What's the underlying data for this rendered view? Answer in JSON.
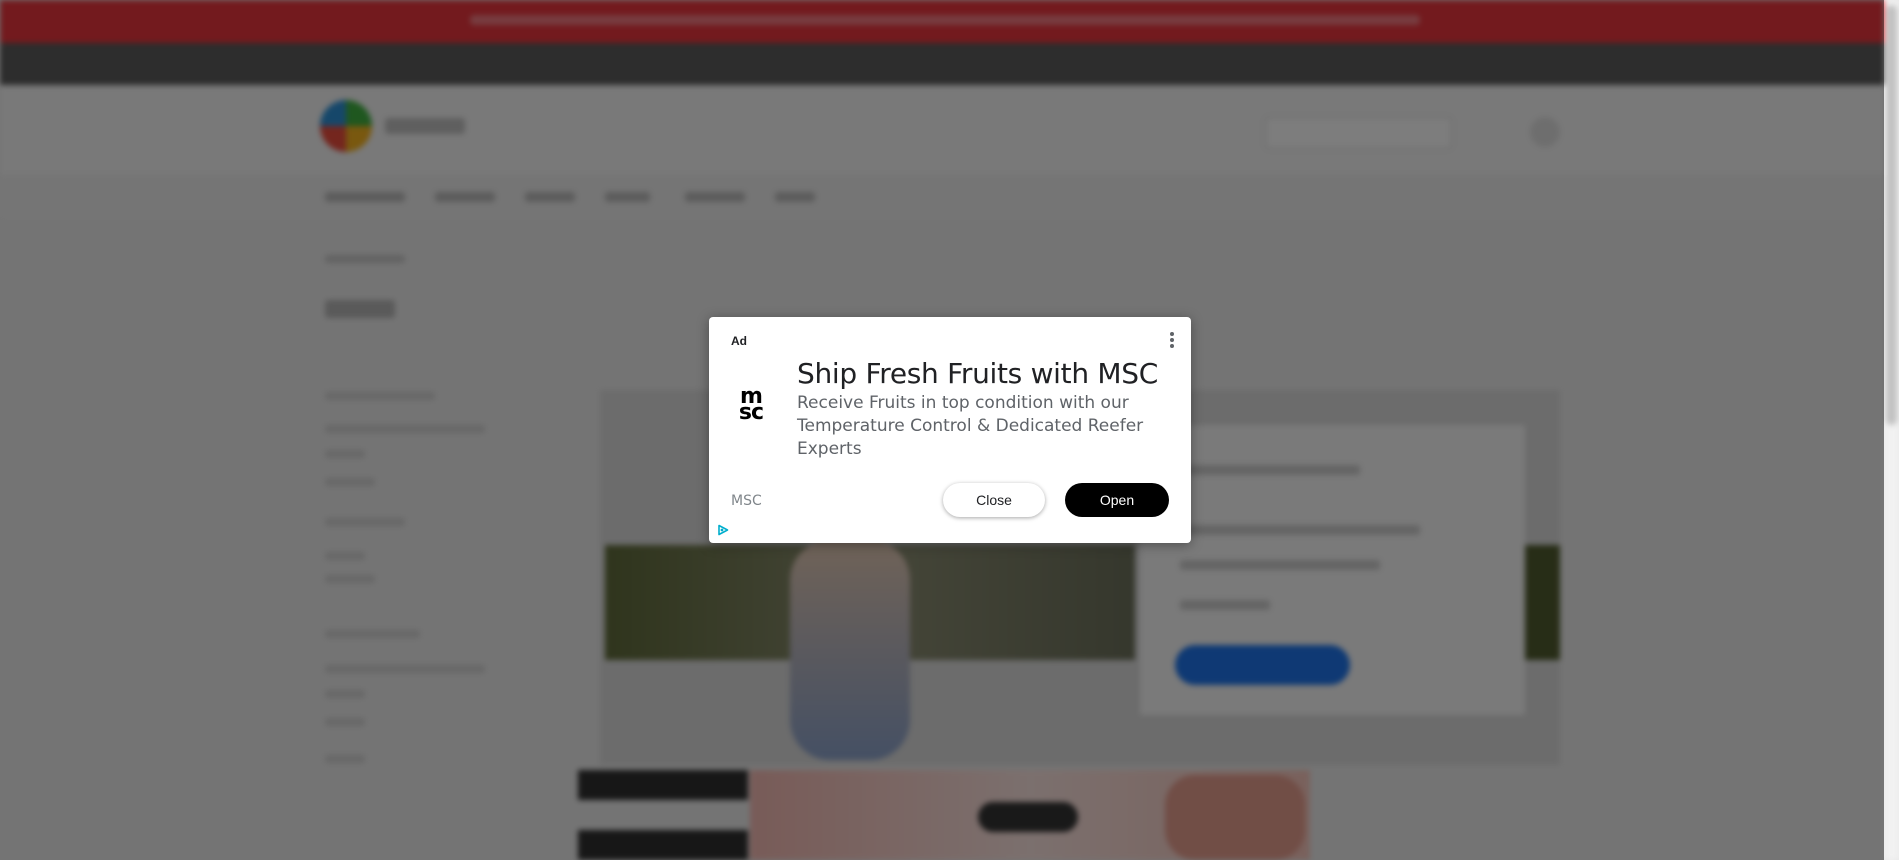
{
  "ad": {
    "label": "Ad",
    "headline": "Ship Fresh Fruits with MSC",
    "body": "Receive Fruits in top condition with our Temperature Control & Dedicated Reefer Experts",
    "advertiser": "MSC",
    "logo_line1": "m",
    "logo_line2": "sc",
    "close_label": "Close",
    "open_label": "Open",
    "icons": {
      "menu": "more-vert-icon",
      "adchoices": "adchoices-icon"
    }
  },
  "colors": {
    "top_banner": "#e6343c",
    "overlay": "rgba(0,0,0,0.5)",
    "open_button": "#000000",
    "cta_blue": "#1e73e8"
  }
}
